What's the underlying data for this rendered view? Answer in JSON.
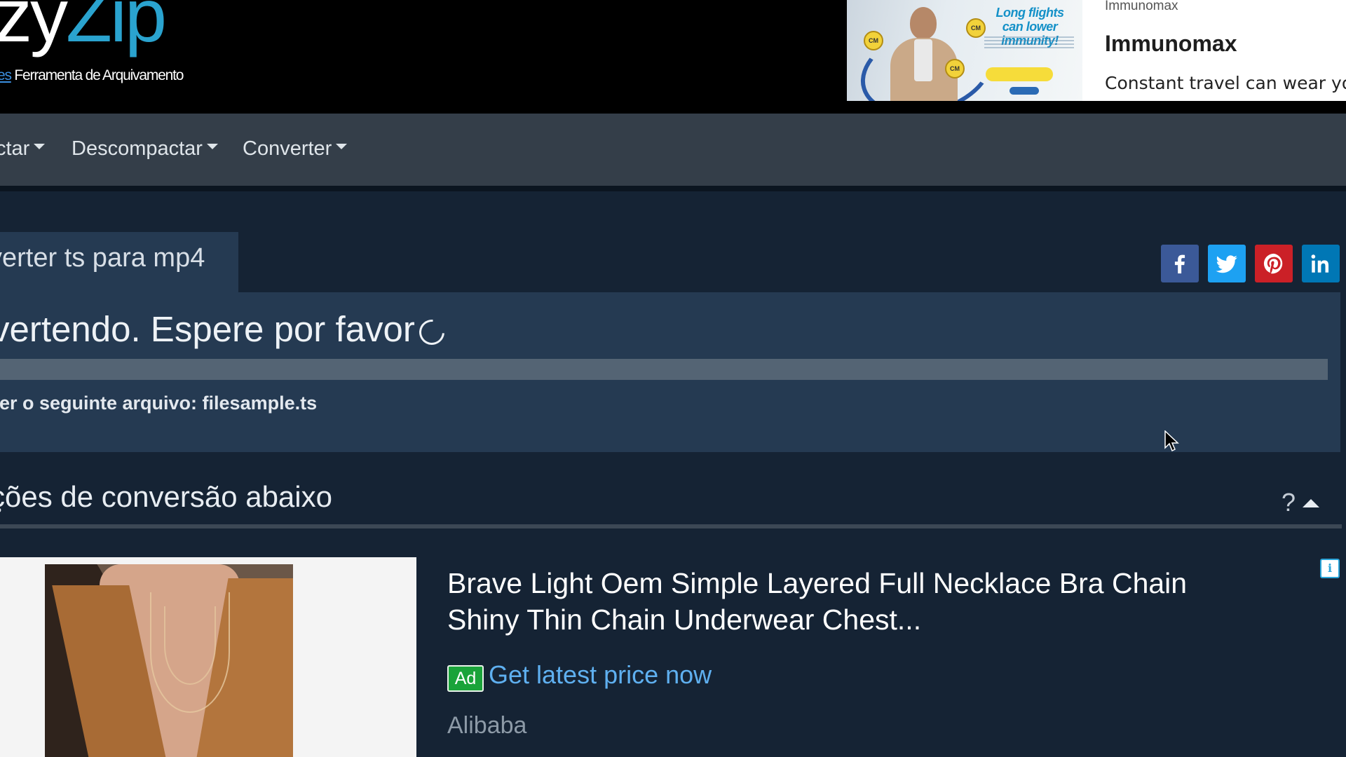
{
  "header": {
    "logo_part1": "zy",
    "logo_part2": "Zip",
    "tagline_link": "es",
    "tagline": " Ferramenta de Arquivamento"
  },
  "top_ad": {
    "image_headline": "Long flights can lower immunity!",
    "source": "Immunomax",
    "title": "Immunomax",
    "description": "Constant travel can wear your"
  },
  "nav": {
    "items": [
      {
        "label": "ctar"
      },
      {
        "label": "Descompactar"
      },
      {
        "label": "Converter"
      }
    ]
  },
  "page": {
    "title": "verter ts para mp4",
    "status": "vertendo. Espere por favor",
    "file_line": "ter o seguinte arquivo: filesample.ts",
    "progress": 0,
    "options_title": "ções de conversão abaixo",
    "help": "?"
  },
  "social": [
    "facebook-icon",
    "twitter-icon",
    "pinterest-icon",
    "linkedin-icon"
  ],
  "bottom_ad": {
    "title": "Brave Light Oem Simple Layered Full Necklace Bra Chain Shiny Thin Chain Underwear Chest...",
    "badge": "Ad",
    "cta": "Get latest price now",
    "seller": "Alibaba",
    "info": "i"
  },
  "colors": {
    "page_bg": "#152334",
    "panel_bg": "#253a52",
    "nav_bg": "#343e49",
    "logo_accent": "#2aa3cf",
    "facebook": "#3b5998",
    "twitter": "#1da1f2",
    "pinterest": "#cb2027",
    "linkedin": "#0077b5",
    "ad_badge": "#1aa33a",
    "cta": "#5fb0f0"
  }
}
